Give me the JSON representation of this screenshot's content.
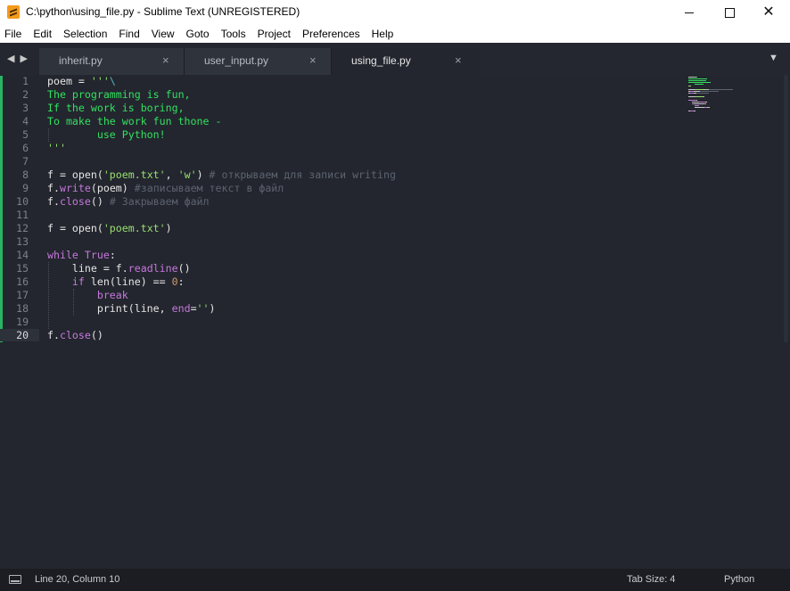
{
  "window": {
    "title": "C:\\python\\using_file.py - Sublime Text (UNREGISTERED)",
    "controls": {
      "minimize": "—",
      "maximize": "☐",
      "close": "✕"
    }
  },
  "menu": [
    "File",
    "Edit",
    "Selection",
    "Find",
    "View",
    "Goto",
    "Tools",
    "Project",
    "Preferences",
    "Help"
  ],
  "tabs": [
    {
      "label": "inherit.py",
      "active": false
    },
    {
      "label": "user_input.py",
      "active": false
    },
    {
      "label": "using_file.py",
      "active": true
    }
  ],
  "tab_close_glyph": "×",
  "nav_arrows": "◀▶",
  "tab_dropdown": "▼",
  "editor": {
    "current_line": 20,
    "line_numbers": [
      "1",
      "2",
      "3",
      "4",
      "5",
      "6",
      "7",
      "8",
      "9",
      "10",
      "11",
      "12",
      "13",
      "14",
      "15",
      "16",
      "17",
      "18",
      "19",
      "20"
    ],
    "lines": [
      [
        {
          "t": "poem = ",
          "c": ""
        },
        {
          "t": "'''",
          "c": "str"
        },
        {
          "t": "\\",
          "c": "esc"
        }
      ],
      [
        {
          "t": "The programming is fun,",
          "c": "strc"
        }
      ],
      [
        {
          "t": "If the work is boring,",
          "c": "strc"
        }
      ],
      [
        {
          "t": "To make the work fun thone -",
          "c": "strc"
        }
      ],
      [
        {
          "t": "        use Python!",
          "c": "strc"
        }
      ],
      [
        {
          "t": "'''",
          "c": "str"
        }
      ],
      [],
      [
        {
          "t": "f = open(",
          "c": ""
        },
        {
          "t": "'poem.txt'",
          "c": "str"
        },
        {
          "t": ", ",
          "c": ""
        },
        {
          "t": "'w'",
          "c": "str"
        },
        {
          "t": ") ",
          "c": ""
        },
        {
          "t": "# открываем для записи writing",
          "c": "cmt"
        }
      ],
      [
        {
          "t": "f.",
          "c": ""
        },
        {
          "t": "write",
          "c": "fn"
        },
        {
          "t": "(poem) ",
          "c": ""
        },
        {
          "t": "#записываем текст в файл",
          "c": "cmt"
        }
      ],
      [
        {
          "t": "f.",
          "c": ""
        },
        {
          "t": "close",
          "c": "fn"
        },
        {
          "t": "() ",
          "c": ""
        },
        {
          "t": "# Закрываем файл",
          "c": "cmt"
        }
      ],
      [],
      [
        {
          "t": "f = open(",
          "c": ""
        },
        {
          "t": "'poem.txt'",
          "c": "str"
        },
        {
          "t": ")",
          "c": ""
        }
      ],
      [],
      [
        {
          "t": "while ",
          "c": "kw"
        },
        {
          "t": "True",
          "c": "kw"
        },
        {
          "t": ":",
          "c": ""
        }
      ],
      [
        {
          "t": "    line = f.",
          "c": ""
        },
        {
          "t": "readline",
          "c": "fn"
        },
        {
          "t": "()",
          "c": ""
        }
      ],
      [
        {
          "t": "    ",
          "c": ""
        },
        {
          "t": "if ",
          "c": "kw"
        },
        {
          "t": "len(line) == ",
          "c": ""
        },
        {
          "t": "0",
          "c": "num"
        },
        {
          "t": ":",
          "c": ""
        }
      ],
      [
        {
          "t": "        ",
          "c": ""
        },
        {
          "t": "break",
          "c": "kw"
        }
      ],
      [
        {
          "t": "        print(line, ",
          "c": ""
        },
        {
          "t": "end",
          "c": "kw"
        },
        {
          "t": "=",
          "c": ""
        },
        {
          "t": "''",
          "c": "str"
        },
        {
          "t": ")",
          "c": ""
        }
      ],
      [],
      [
        {
          "t": "f.",
          "c": ""
        },
        {
          "t": "close",
          "c": "fn"
        },
        {
          "t": "()",
          "c": ""
        }
      ]
    ]
  },
  "status": {
    "position": "Line 20, Column 10",
    "tab_size": "Tab Size: 4",
    "syntax": "Python"
  }
}
